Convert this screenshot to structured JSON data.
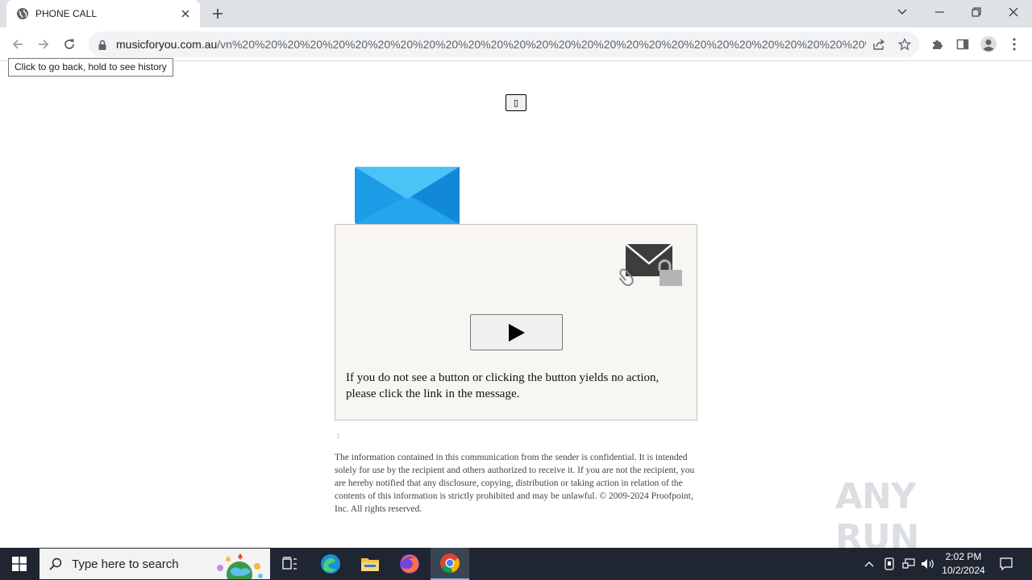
{
  "browser": {
    "tab_title": "PHONE CALL",
    "url_host": "musicforyou.com.au",
    "url_path": "/vn%20%20%20%20%20%20%20%20%20%20%20%20%20%20%20%20%20%20%20%20%20%20%20%20%20%20%20%20%20%20%20%20%20%2...",
    "tooltip": "Click to go back, hold to see history"
  },
  "page": {
    "small_box_glyph": "▯",
    "panel_message": "If you do not see a button or clicking the button yields no action, please click the link in the message.",
    "colon": ":",
    "disclaimer": "The information contained in this communication from the sender is confidential. It is intended solely for use by the recipient and others authorized to receive it. If you are not the recipient, you are hereby notified that any disclosure, copying, distribution or taking action in relation of the contents of this information is strictly prohibited and may be unlawful. © 2009-2024 Proofpoint, Inc. All rights reserved.",
    "watermark": "ANY RUN"
  },
  "taskbar": {
    "search_placeholder": "Type here to search",
    "time": "2:02 PM",
    "date": "10/2/2024"
  },
  "colors": {
    "envelope_light": "#4cc3f7",
    "envelope_dark": "#1289d8",
    "panel_bg": "#f8f6f3",
    "taskbar_bg": "#1f2631"
  }
}
